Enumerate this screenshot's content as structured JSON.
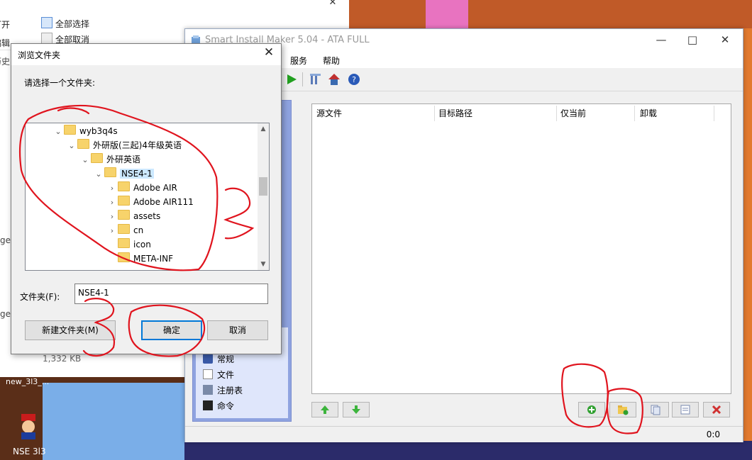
{
  "explorer": {
    "open_label": "打开",
    "select_all": "全部选择",
    "deselect_all": "全部取消",
    "edit_fragment": "编辑",
    "history_fragment": "历史",
    "file_size": "1,332 KB",
    "ge_fragment_1": "ge",
    "ge_fragment_2": "ge"
  },
  "desktop": {
    "new_file_label": "new_3l3_...",
    "nse_label": "NSE 3l3"
  },
  "app": {
    "title": "Smart Install Maker 5.04 - ATA FULL",
    "menu": [
      "服务",
      "帮助"
    ],
    "columns": [
      "源文件",
      "目标路径",
      "仅当前",
      "卸载"
    ],
    "sidebar_items": [
      "常规",
      "文件",
      "注册表",
      "命令"
    ],
    "status": "0:0"
  },
  "dialog": {
    "title": "浏览文件夹",
    "prompt": "请选择一个文件夹:",
    "tree": [
      {
        "label": "wyb3q4s",
        "expanded": true
      },
      {
        "label": "外研版(三起)4年级英语",
        "expanded": true
      },
      {
        "label": "外研英语",
        "expanded": true
      },
      {
        "label": "NSE4-1",
        "expanded": true,
        "selected": true
      },
      {
        "label": "Adobe AIR",
        "expanded": false
      },
      {
        "label": "Adobe AIR111",
        "expanded": false
      },
      {
        "label": "assets",
        "expanded": false
      },
      {
        "label": "cn",
        "expanded": false
      },
      {
        "label": "icon",
        "expanded": false
      },
      {
        "label": "META-INF",
        "expanded": false
      }
    ],
    "folder_label": "文件夹(F):",
    "folder_value": "NSE4-1",
    "new_folder_button": "新建文件夹(M)",
    "ok_button": "确定",
    "cancel_button": "取消"
  },
  "annotations": [
    "1",
    "2",
    "3"
  ],
  "colors": {
    "annotation_red": "#e0141e",
    "selection_blue": "#cce8ff",
    "accent_blue": "#0078d7",
    "sidebar_blue": "#8fa3e0"
  }
}
